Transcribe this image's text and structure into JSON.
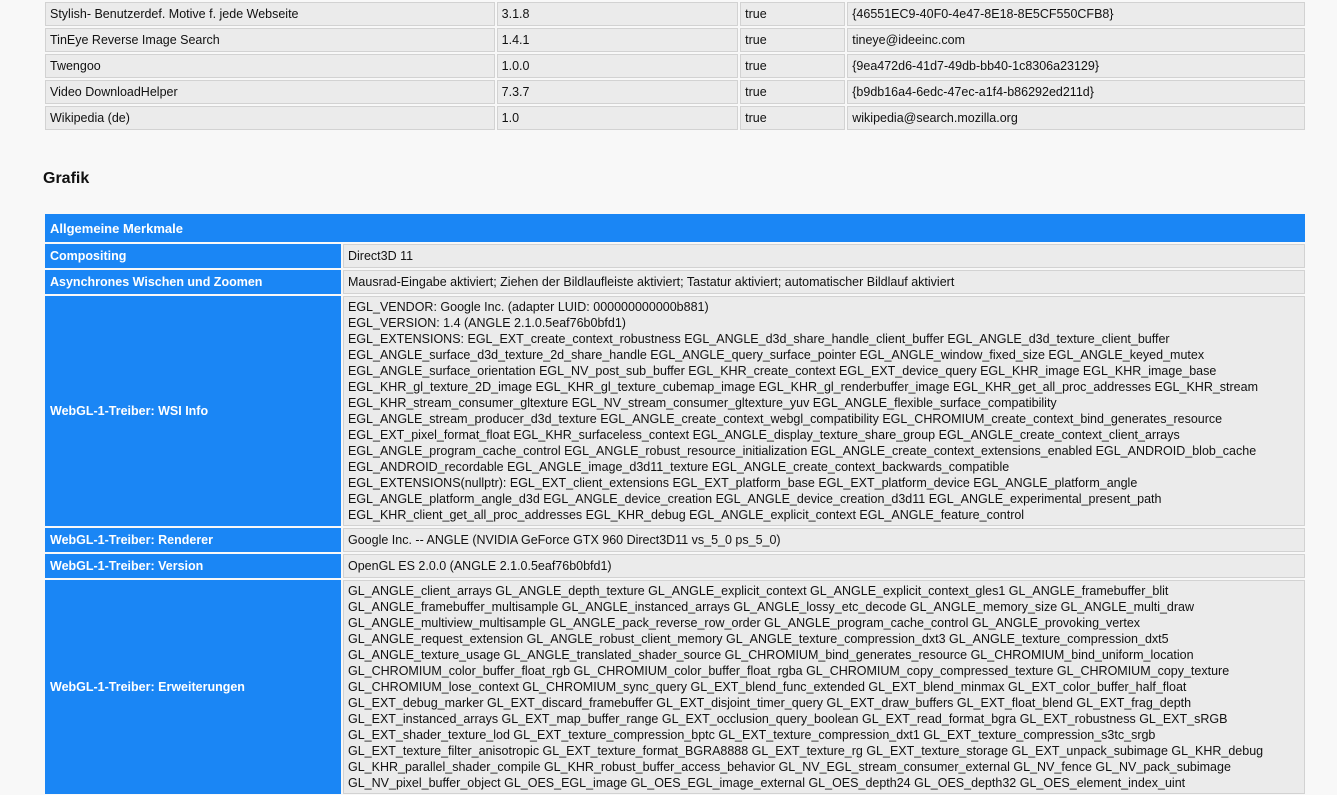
{
  "extensions": [
    [
      "Stylish- Benutzerdef. Motive f. jede Webseite",
      "3.1.8",
      "true",
      "{46551EC9-40F0-4e47-8E18-8E5CF550CFB8}"
    ],
    [
      "TinEye Reverse Image Search",
      "1.4.1",
      "true",
      "tineye@ideeinc.com"
    ],
    [
      "Twengoo",
      "1.0.0",
      "true",
      "{9ea472d6-41d7-49db-bb40-1c8306a23129}"
    ],
    [
      "Video DownloadHelper",
      "7.3.7",
      "true",
      "{b9db16a4-6edc-47ec-a1f4-b86292ed211d}"
    ],
    [
      "Wikipedia (de)",
      "1.0",
      "true",
      "wikipedia@search.mozilla.org"
    ]
  ],
  "graphics": {
    "heading": "Grafik",
    "group_label": "Allgemeine Merkmale",
    "rows": [
      {
        "key": "Compositing",
        "lines": [
          "Direct3D 11"
        ]
      },
      {
        "key": "Asynchrones Wischen und Zoomen",
        "lines": [
          "Mausrad-Eingabe aktiviert; Ziehen der Bildlaufleiste aktiviert; Tastatur aktiviert; automatischer Bildlauf aktiviert"
        ]
      },
      {
        "key": "WebGL-1-Treiber: WSI Info",
        "lines": [
          "EGL_VENDOR: Google Inc. (adapter LUID: 000000000000b881)",
          "EGL_VERSION: 1.4 (ANGLE 2.1.0.5eaf76b0bfd1)",
          "EGL_EXTENSIONS: EGL_EXT_create_context_robustness EGL_ANGLE_d3d_share_handle_client_buffer EGL_ANGLE_d3d_texture_client_buffer",
          "EGL_ANGLE_surface_d3d_texture_2d_share_handle EGL_ANGLE_query_surface_pointer EGL_ANGLE_window_fixed_size EGL_ANGLE_keyed_mutex",
          "EGL_ANGLE_surface_orientation EGL_NV_post_sub_buffer EGL_KHR_create_context EGL_EXT_device_query EGL_KHR_image EGL_KHR_image_base",
          "EGL_KHR_gl_texture_2D_image EGL_KHR_gl_texture_cubemap_image EGL_KHR_gl_renderbuffer_image EGL_KHR_get_all_proc_addresses EGL_KHR_stream",
          "EGL_KHR_stream_consumer_gltexture EGL_NV_stream_consumer_gltexture_yuv EGL_ANGLE_flexible_surface_compatibility",
          "EGL_ANGLE_stream_producer_d3d_texture EGL_ANGLE_create_context_webgl_compatibility EGL_CHROMIUM_create_context_bind_generates_resource",
          "EGL_EXT_pixel_format_float EGL_KHR_surfaceless_context EGL_ANGLE_display_texture_share_group EGL_ANGLE_create_context_client_arrays",
          "EGL_ANGLE_program_cache_control EGL_ANGLE_robust_resource_initialization EGL_ANGLE_create_context_extensions_enabled EGL_ANDROID_blob_cache",
          "EGL_ANDROID_recordable EGL_ANGLE_image_d3d11_texture EGL_ANGLE_create_context_backwards_compatible",
          "EGL_EXTENSIONS(nullptr): EGL_EXT_client_extensions EGL_EXT_platform_base EGL_EXT_platform_device EGL_ANGLE_platform_angle",
          "EGL_ANGLE_platform_angle_d3d EGL_ANGLE_device_creation EGL_ANGLE_device_creation_d3d11 EGL_ANGLE_experimental_present_path",
          "EGL_KHR_client_get_all_proc_addresses EGL_KHR_debug EGL_ANGLE_explicit_context EGL_ANGLE_feature_control"
        ]
      },
      {
        "key": "WebGL-1-Treiber: Renderer",
        "lines": [
          "Google Inc. -- ANGLE (NVIDIA GeForce GTX 960 Direct3D11 vs_5_0 ps_5_0)"
        ]
      },
      {
        "key": "WebGL-1-Treiber: Version",
        "lines": [
          "OpenGL ES 2.0.0 (ANGLE 2.1.0.5eaf76b0bfd1)"
        ]
      },
      {
        "key": "WebGL-1-Treiber: Erweiterungen",
        "lines": [
          "GL_ANGLE_client_arrays GL_ANGLE_depth_texture GL_ANGLE_explicit_context GL_ANGLE_explicit_context_gles1 GL_ANGLE_framebuffer_blit",
          "GL_ANGLE_framebuffer_multisample GL_ANGLE_instanced_arrays GL_ANGLE_lossy_etc_decode GL_ANGLE_memory_size GL_ANGLE_multi_draw",
          "GL_ANGLE_multiview_multisample GL_ANGLE_pack_reverse_row_order GL_ANGLE_program_cache_control GL_ANGLE_provoking_vertex",
          "GL_ANGLE_request_extension GL_ANGLE_robust_client_memory GL_ANGLE_texture_compression_dxt3 GL_ANGLE_texture_compression_dxt5",
          "GL_ANGLE_texture_usage GL_ANGLE_translated_shader_source GL_CHROMIUM_bind_generates_resource GL_CHROMIUM_bind_uniform_location",
          "GL_CHROMIUM_color_buffer_float_rgb GL_CHROMIUM_color_buffer_float_rgba GL_CHROMIUM_copy_compressed_texture GL_CHROMIUM_copy_texture",
          "GL_CHROMIUM_lose_context GL_CHROMIUM_sync_query GL_EXT_blend_func_extended GL_EXT_blend_minmax GL_EXT_color_buffer_half_float",
          "GL_EXT_debug_marker GL_EXT_discard_framebuffer GL_EXT_disjoint_timer_query GL_EXT_draw_buffers GL_EXT_float_blend GL_EXT_frag_depth",
          "GL_EXT_instanced_arrays GL_EXT_map_buffer_range GL_EXT_occlusion_query_boolean GL_EXT_read_format_bgra GL_EXT_robustness GL_EXT_sRGB",
          "GL_EXT_shader_texture_lod GL_EXT_texture_compression_bptc GL_EXT_texture_compression_dxt1 GL_EXT_texture_compression_s3tc_srgb",
          "GL_EXT_texture_filter_anisotropic GL_EXT_texture_format_BGRA8888 GL_EXT_texture_rg GL_EXT_texture_storage GL_EXT_unpack_subimage GL_KHR_debug",
          "GL_KHR_parallel_shader_compile GL_KHR_robust_buffer_access_behavior GL_NV_EGL_stream_consumer_external GL_NV_fence GL_NV_pack_subimage",
          "GL_NV_pixel_buffer_object GL_OES_EGL_image GL_OES_EGL_image_external GL_OES_depth24 GL_OES_depth32 GL_OES_element_index_uint"
        ]
      }
    ]
  }
}
